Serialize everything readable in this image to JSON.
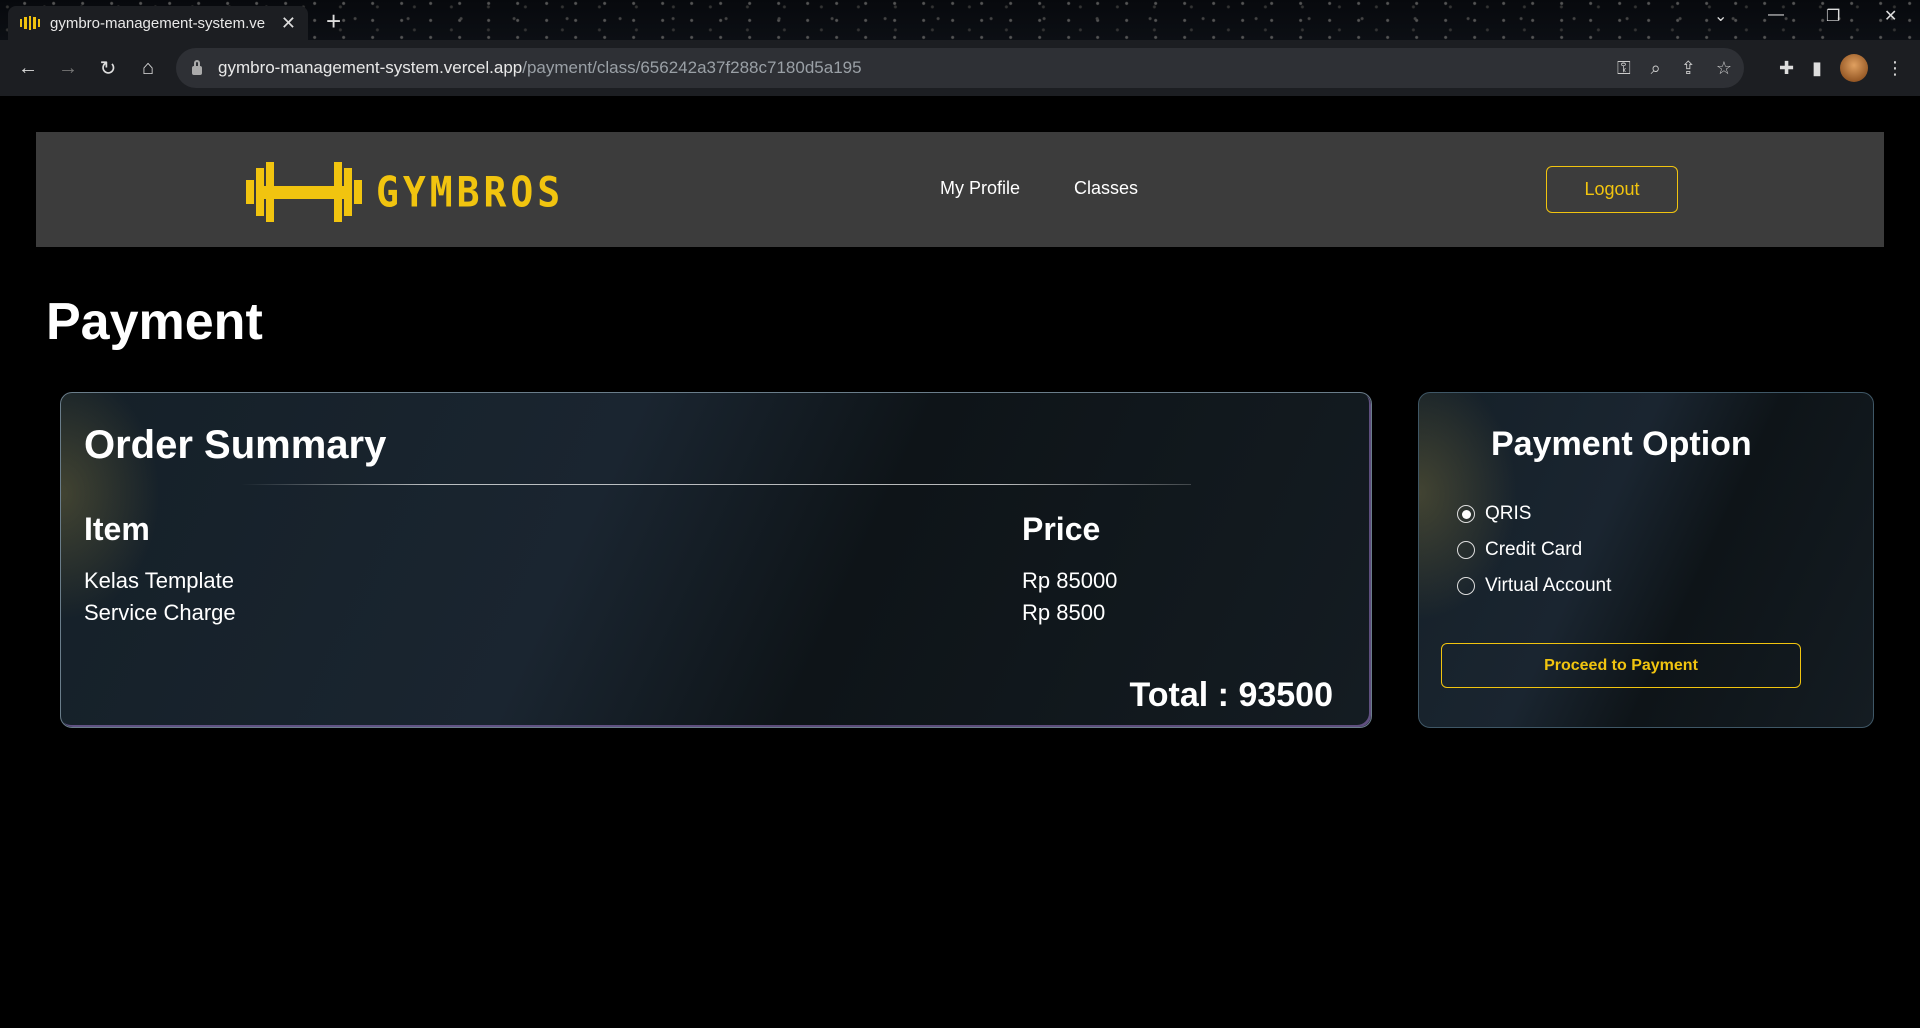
{
  "browser": {
    "tab_title": "gymbro-management-system.ve",
    "url_host": "gymbro-management-system.vercel.app",
    "url_path": "/payment/class/656242a37f288c7180d5a195"
  },
  "header": {
    "logo_text": "GYMBROS",
    "nav": [
      {
        "label": "My Profile"
      },
      {
        "label": "Classes"
      }
    ],
    "logout_label": "Logout"
  },
  "page": {
    "title": "Payment"
  },
  "order_summary": {
    "title": "Order Summary",
    "item_header": "Item",
    "price_header": "Price",
    "rows": [
      {
        "item": "Kelas Template",
        "price": "Rp 85000"
      },
      {
        "item": "Service Charge",
        "price": "Rp 8500"
      }
    ],
    "total": "Total : 93500"
  },
  "payment_option": {
    "title": "Payment Option",
    "options": [
      {
        "label": "QRIS",
        "checked": true
      },
      {
        "label": "Credit Card",
        "checked": false
      },
      {
        "label": "Virtual Account",
        "checked": false
      }
    ],
    "proceed_label": "Proceed to Payment"
  },
  "colors": {
    "accent": "#f1c40f",
    "header_bg": "#3c3c3c",
    "page_bg": "#000000"
  }
}
